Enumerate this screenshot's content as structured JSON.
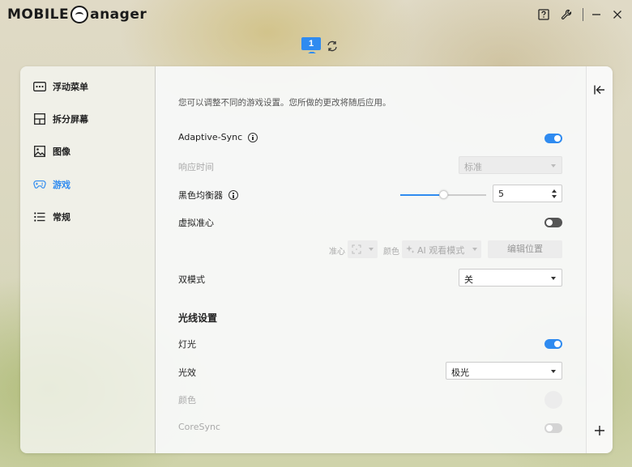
{
  "app": {
    "logo_text_left": "MOBILE",
    "logo_text_right": "anager"
  },
  "titlebar": {
    "help": "?"
  },
  "monitor": {
    "number": "1"
  },
  "sidebar": {
    "items": [
      {
        "label": "浮动菜单",
        "icon": "menu-dots-icon"
      },
      {
        "label": "拆分屏幕",
        "icon": "split-screen-icon"
      },
      {
        "label": "图像",
        "icon": "image-icon"
      },
      {
        "label": "游戏",
        "icon": "gamepad-icon",
        "active": true
      },
      {
        "label": "常规",
        "icon": "list-icon"
      }
    ]
  },
  "content": {
    "description": "您可以调整不同的游戏设置。您所做的更改将随后应用。",
    "adaptive_sync": {
      "label": "Adaptive-Sync",
      "enabled": true
    },
    "response_time": {
      "label": "响应时间",
      "value": "标准"
    },
    "black_equalizer": {
      "label": "黑色均衡器",
      "value": "5",
      "slider_fraction": 0.5
    },
    "crosshair": {
      "label": "虚拟准心",
      "enabled": false,
      "crosshair_label": "准心",
      "color_label": "颜色",
      "mode_value": "AI 观看模式",
      "edit_button": "编辑位置"
    },
    "dual_mode": {
      "label": "双模式",
      "value": "关"
    },
    "lighting_title": "光线设置",
    "light": {
      "label": "灯光",
      "enabled": true
    },
    "light_effect": {
      "label": "光效",
      "value": "极光"
    },
    "color": {
      "label": "颜色"
    },
    "coresync": {
      "label": "CoreSync",
      "enabled": false
    }
  },
  "colors": {
    "accent": "#2f8bf0"
  }
}
